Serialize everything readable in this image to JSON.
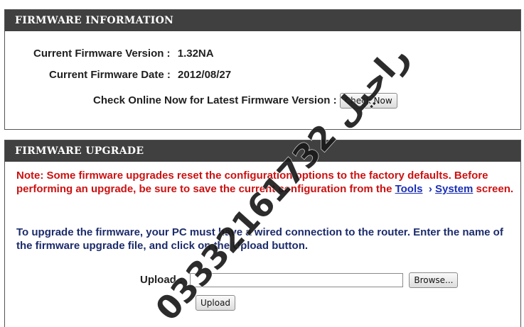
{
  "firmware_info": {
    "header": "FIRMWARE INFORMATION",
    "version_label": "Current Firmware Version :",
    "version_value": "1.32NA",
    "date_label": "Current Firmware Date :",
    "date_value": "2012/08/27",
    "check_label": "Check Online Now for Latest Firmware Version :",
    "check_button": "Check Now"
  },
  "firmware_upgrade": {
    "header": "FIRMWARE UPGRADE",
    "note_text": "Note: Some firmware upgrades reset the configuration options to the factory defaults. Before performing an upgrade, be sure to save the current configuration from the ",
    "note_link_tools": "Tools",
    "note_link_sep": "›",
    "note_link_system": "System",
    "note_suffix": " screen.",
    "info_text": "To upgrade the firmware, your PC must have a wired connection to the router. Enter the name of the firmware upgrade file, and click on the Upload button.",
    "upload_label": "Upload :",
    "upload_value": "",
    "browse_button": "Browse...",
    "upload_button": "Upload"
  },
  "watermark": {
    "text": "راحيل 03332161732",
    "color": "#1a1a1a"
  }
}
